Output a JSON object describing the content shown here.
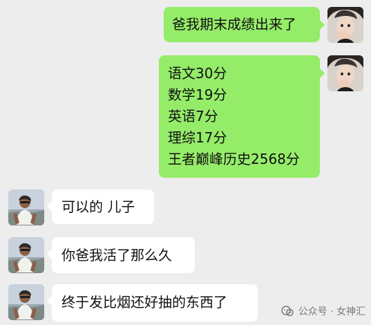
{
  "messages": [
    {
      "side": "sent",
      "avatar_icon": "young-person-avatar-icon",
      "lines": [
        "爸我期末成绩出来了"
      ]
    },
    {
      "side": "sent",
      "avatar_icon": "young-person-avatar-icon",
      "lines": [
        "语文30分",
        "数学19分",
        "英语7分",
        "理综17分",
        "王者巅峰历史2568分"
      ]
    },
    {
      "side": "recv",
      "avatar_icon": "father-avatar-icon",
      "lines": [
        "可以的 儿子"
      ]
    },
    {
      "side": "recv",
      "avatar_icon": "father-avatar-icon",
      "lines": [
        "你爸我活了那么久"
      ]
    },
    {
      "side": "recv",
      "avatar_icon": "father-avatar-icon",
      "lines": [
        "终于发比烟还好抽的东西了"
      ]
    }
  ],
  "watermark": {
    "icon": "wechat-official-account-icon",
    "text": "公众号 · 女神汇"
  },
  "colors": {
    "background": "#ededed",
    "sent_bubble": "#95ec69",
    "received_bubble": "#ffffff"
  }
}
